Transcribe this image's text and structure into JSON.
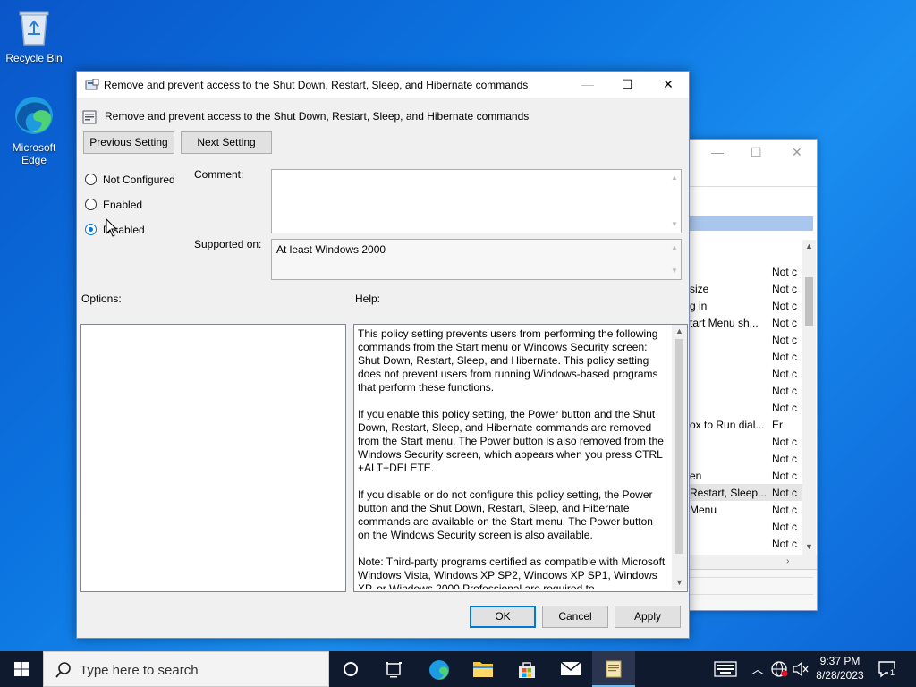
{
  "desktop": {
    "icons": [
      {
        "label": "Recycle Bin"
      },
      {
        "label": "Microsoft Edge"
      }
    ]
  },
  "background_window": {
    "rows": [
      {
        "name": "",
        "state": "Not c"
      },
      {
        "name": "size",
        "state": "Not c"
      },
      {
        "name": "g in",
        "state": "Not c"
      },
      {
        "name": "tart Menu sh...",
        "state": "Not c"
      },
      {
        "name": "",
        "state": "Not c"
      },
      {
        "name": "",
        "state": "Not c"
      },
      {
        "name": "",
        "state": "Not c"
      },
      {
        "name": "",
        "state": "Not c"
      },
      {
        "name": "",
        "state": "Not c"
      },
      {
        "name": "ox to Run dial...",
        "state": "Er"
      },
      {
        "name": "",
        "state": "Not c"
      },
      {
        "name": "",
        "state": "Not c"
      },
      {
        "name": "en",
        "state": "Not c"
      },
      {
        "name": " Restart, Sleep...",
        "state": "Not c"
      },
      {
        "name": "Menu",
        "state": "Not c"
      },
      {
        "name": "",
        "state": "Not c"
      },
      {
        "name": "",
        "state": "Not c"
      }
    ]
  },
  "dialog": {
    "title": "Remove and prevent access to the Shut Down, Restart, Sleep, and Hibernate commands",
    "subtitle": "Remove and prevent access to the Shut Down, Restart, Sleep, and Hibernate commands",
    "prev_label": "Previous Setting",
    "next_label": "Next Setting",
    "radio": {
      "not_configured": "Not Configured",
      "enabled": "Enabled",
      "disabled": "Disabled",
      "selected": "disabled"
    },
    "comment_label": "Comment:",
    "comment_value": "",
    "supported_label": "Supported on:",
    "supported_value": "At least Windows 2000",
    "options_label": "Options:",
    "help_label": "Help:",
    "help": [
      "This policy setting prevents users from performing the following commands from the Start menu or Windows Security screen: Shut Down, Restart, Sleep, and Hibernate. This policy setting does not prevent users from running Windows-based programs that perform these functions.",
      "If you enable this policy setting, the Power button and the Shut Down, Restart, Sleep, and Hibernate commands are removed from the Start menu. The Power button is also removed from the Windows Security screen, which appears when you press CTRL +ALT+DELETE.",
      "If you disable or do not configure this policy setting, the Power button and the Shut Down, Restart, Sleep, and Hibernate commands are available on the Start menu. The Power button on the Windows Security screen is also available.",
      "Note: Third-party programs certified as compatible with Microsoft Windows Vista, Windows XP SP2, Windows XP SP1, Windows XP, or Windows 2000 Professional are required to"
    ],
    "ok_label": "OK",
    "cancel_label": "Cancel",
    "apply_label": "Apply"
  },
  "taskbar": {
    "search_placeholder": "Type here to search",
    "time": "9:37 PM",
    "date": "8/28/2023",
    "notification_count": "1"
  },
  "colors": {
    "accent": "#0078d7",
    "taskbar": "#101a2e",
    "desktop": "#0b74e0"
  }
}
